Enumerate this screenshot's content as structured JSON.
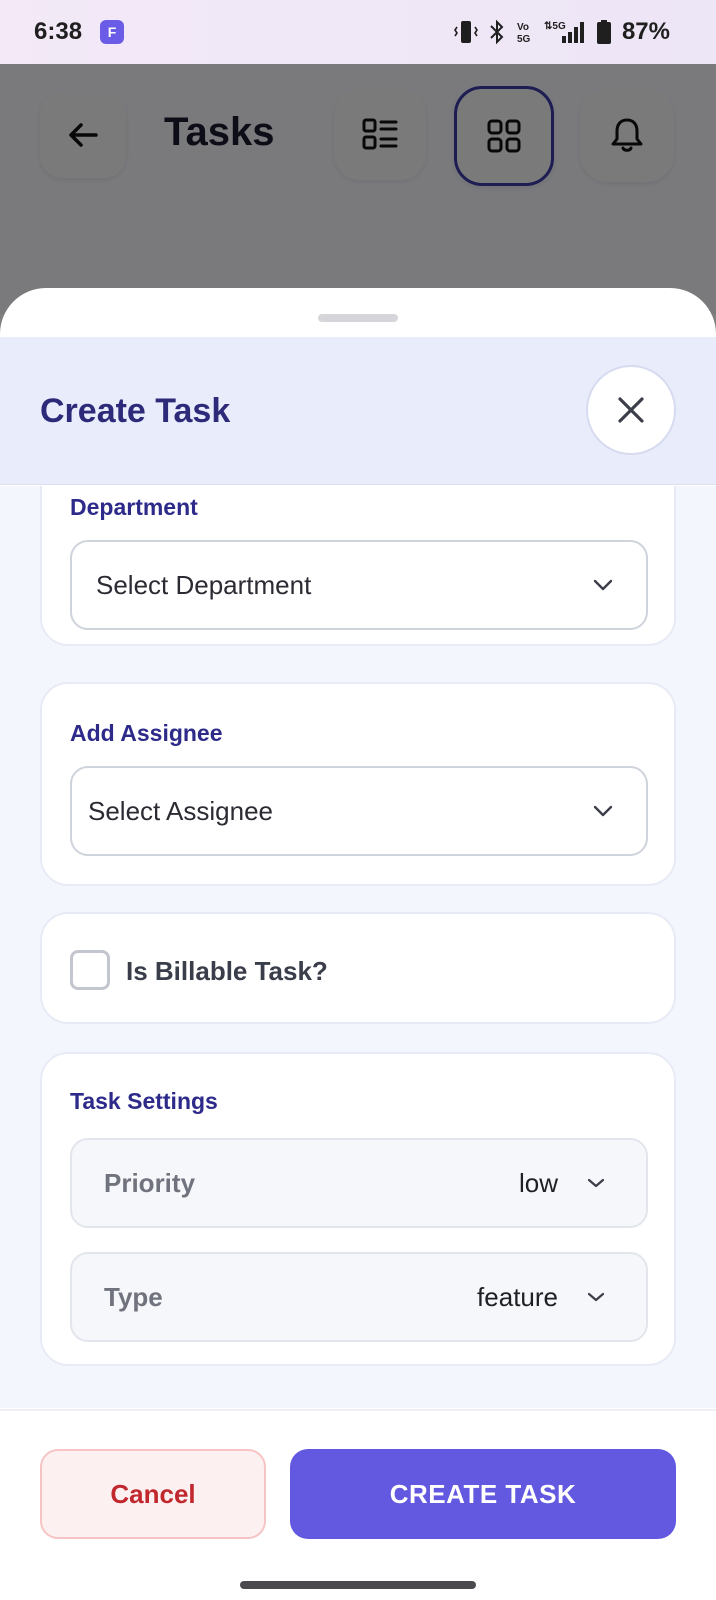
{
  "status_bar": {
    "time": "6:38",
    "app_badge": "F",
    "battery": "87%"
  },
  "header": {
    "title": "Tasks",
    "icons": [
      "back-arrow-icon",
      "list-view-icon",
      "grid-view-icon",
      "bell-icon"
    ]
  },
  "sheet": {
    "title": "Create Task",
    "department": {
      "label": "Department",
      "placeholder": "Select Department"
    },
    "assignee": {
      "label": "Add Assignee",
      "placeholder": "Select Assignee"
    },
    "billable": {
      "label": "Is Billable Task?",
      "checked": false
    },
    "settings": {
      "label": "Task Settings",
      "priority": {
        "name": "Priority",
        "value": "low"
      },
      "type": {
        "name": "Type",
        "value": "feature"
      }
    },
    "buttons": {
      "cancel": "Cancel",
      "create": "CREATE TASK"
    }
  },
  "colors": {
    "accent": "#6359e0",
    "label": "#2d2a8a",
    "cancel_text": "#c0282d"
  }
}
